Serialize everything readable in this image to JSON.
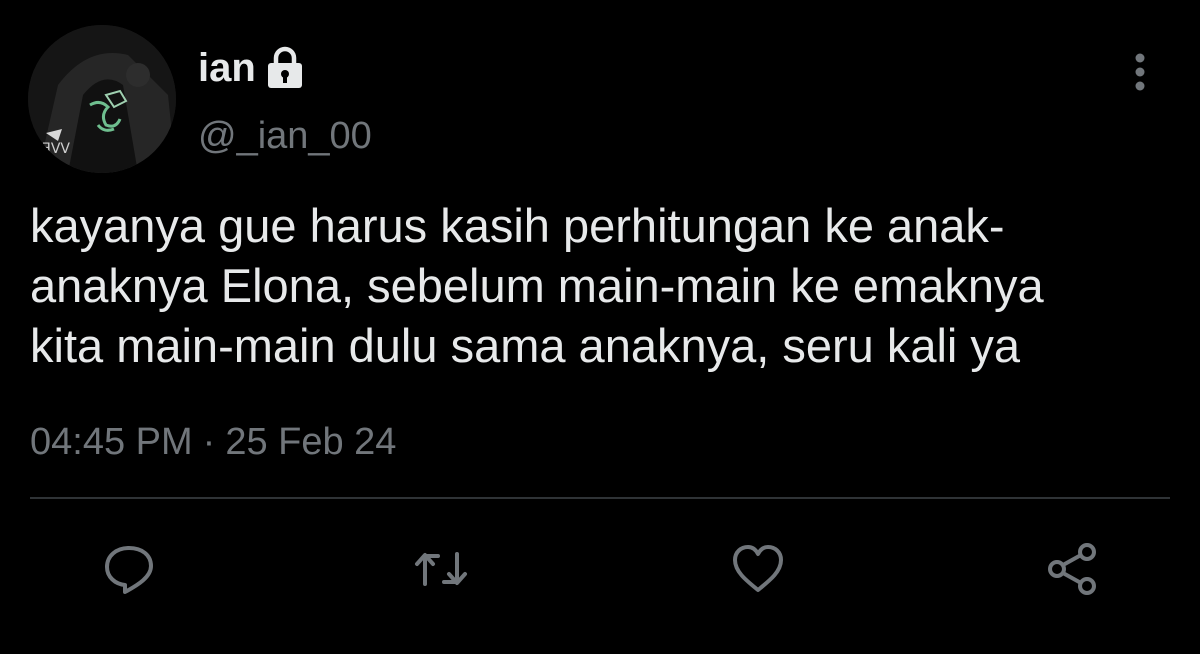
{
  "author": {
    "display_name": "ian",
    "handle": "@_ian_00",
    "protected": true
  },
  "tweet": {
    "lines": [
      "kayanya gue harus kasih perhitungan ke anak-",
      "anaknya Elona, sebelum main-main ke emaknya",
      "kita main-main dulu sama anaknya, seru kali ya"
    ],
    "time": "04:45 PM",
    "separator": "·",
    "date": "25 Feb 24"
  },
  "icons": {
    "lock": "lock-icon",
    "more": "more-vertical-icon",
    "reply": "reply-icon",
    "retweet": "retweet-icon",
    "like": "heart-icon",
    "share": "share-icon"
  },
  "colors": {
    "background": "#000000",
    "text_primary": "#e7e9ea",
    "text_secondary": "#71767b",
    "divider": "#2f3336"
  }
}
